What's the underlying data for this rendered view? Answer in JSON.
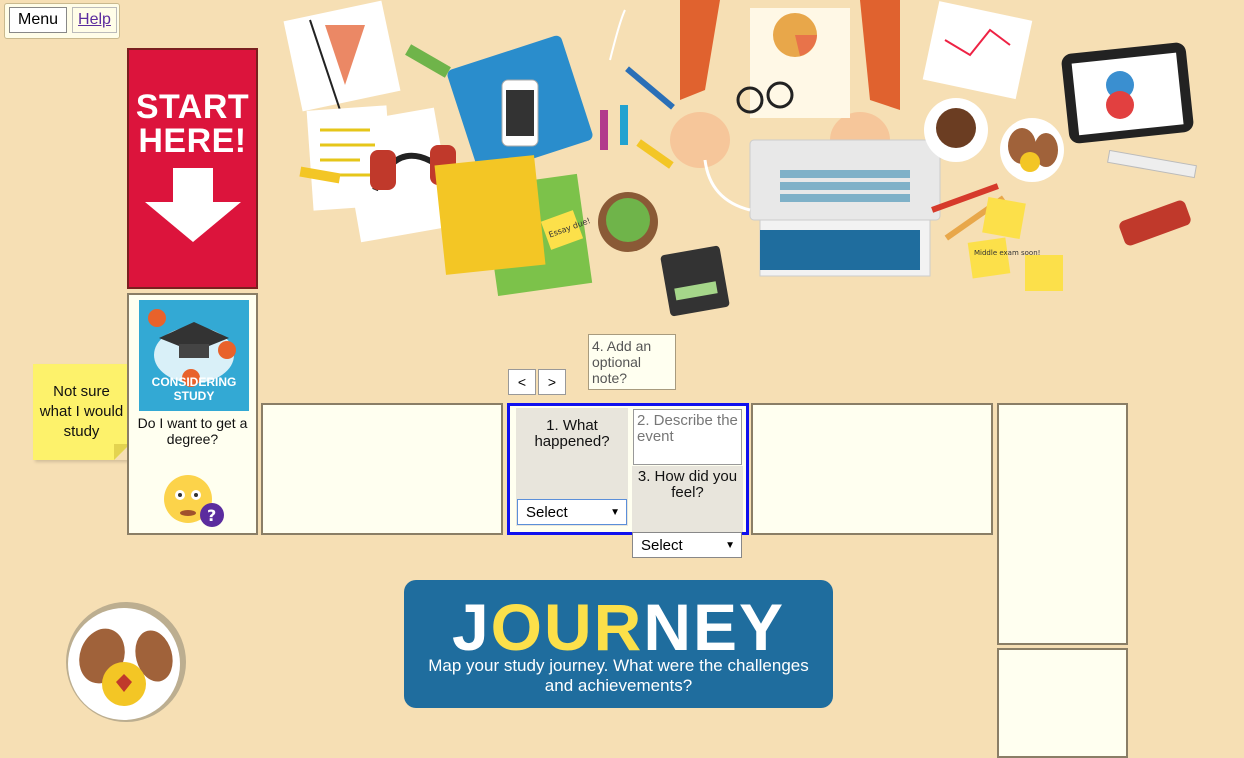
{
  "topbar": {
    "menu_label": "Menu",
    "help_label": "Help"
  },
  "start_banner": {
    "text": "START HERE!"
  },
  "sticky_note": {
    "text": "Not sure what I would study"
  },
  "step1": {
    "card_label": "CONSIDERING STUDY",
    "text": "Do I want to get a degree?"
  },
  "note_prompt": "4. Add an optional note?",
  "nav": {
    "prev_label": "<",
    "next_label": ">"
  },
  "form": {
    "q1_label": "1. What happened?",
    "q1_select_value": "Select",
    "q2_placeholder": "2. Describe the event",
    "q3_label": "3. How did you feel?",
    "q3_select_value": "Select"
  },
  "journey": {
    "title_part1": "JOUR",
    "title_part2": "NEY",
    "subtitle": "Map your study journey. What were the challenges and achievements?"
  },
  "illustration": {
    "essay_note": "Essay due!",
    "exam_note": "Middle exam soon!"
  },
  "colors": {
    "background": "#f6dfb4",
    "start_red": "#dc143c",
    "journey_blue": "#1f6d9e",
    "accent_yellow": "#fce04a",
    "active_border": "#1010ee"
  }
}
